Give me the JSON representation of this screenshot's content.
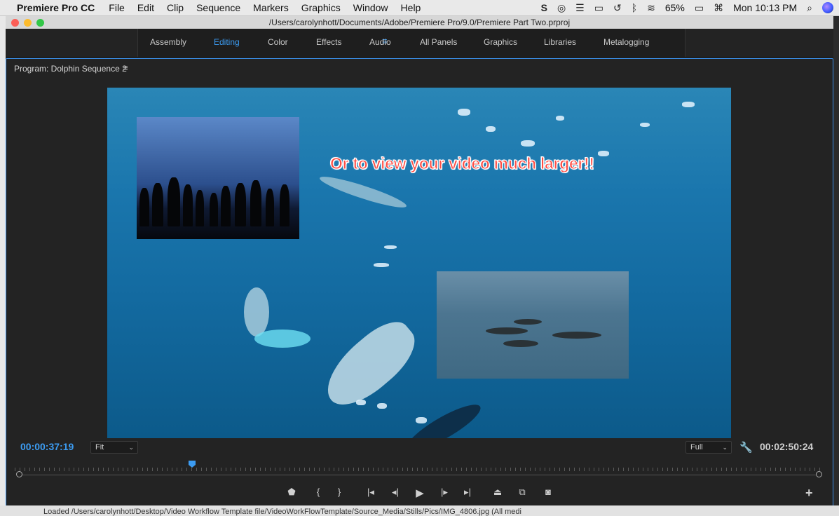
{
  "menubar": {
    "app_name": "Premiere Pro CC",
    "items": [
      "File",
      "Edit",
      "Clip",
      "Sequence",
      "Markers",
      "Graphics",
      "Window",
      "Help"
    ],
    "battery": "65%",
    "clock": "Mon 10:13 PM"
  },
  "window": {
    "title": "/Users/carolynhott/Documents/Adobe/Premiere Pro/9.0/Premiere Part Two.prproj"
  },
  "workspaces": {
    "tabs": [
      "Assembly",
      "Editing",
      "Color",
      "Effects",
      "Audio",
      "All Panels",
      "Graphics",
      "Libraries",
      "Metalogging"
    ],
    "active": "Editing"
  },
  "program_panel": {
    "title": "Program: Dolphin Sequence 2",
    "caption": "Or to view your video much larger!!",
    "current_time": "00:00:37:19",
    "duration": "00:02:50:24",
    "zoom_select": "Fit",
    "resolution_select": "Full"
  },
  "statusbar": {
    "text": "Loaded /Users/carolynhott/Desktop/Video Workflow Template file/VideoWorkFlowTemplate/Source_Media/Stills/Pics/IMG_4806.jpg (All medi"
  },
  "colors": {
    "accent": "#3c9cf2",
    "caption": "#ff4d44",
    "panel_bg": "#232323"
  }
}
